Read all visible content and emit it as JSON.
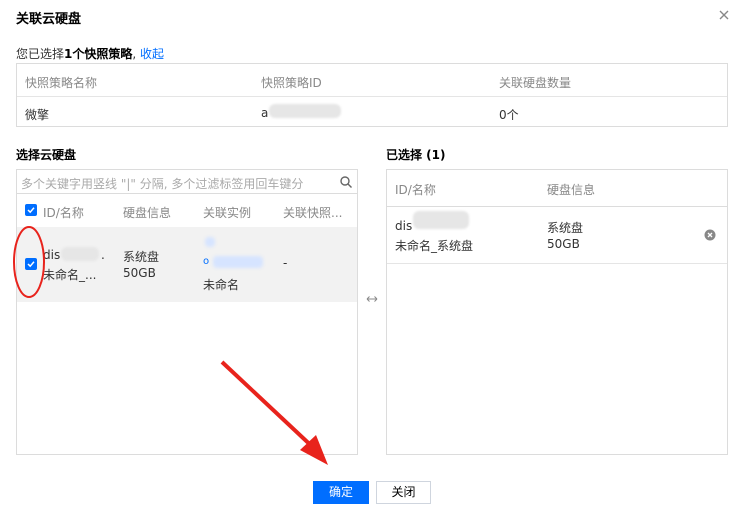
{
  "dialog": {
    "title": "关联云硬盘",
    "summary_prefix": "您已选择",
    "summary_count": "1个快照策略",
    "summary_sep": ", ",
    "collapse_link": "收起"
  },
  "policy_table": {
    "headers": [
      "快照策略名称",
      "快照策略ID",
      "关联硬盘数量"
    ],
    "row": {
      "name": "微擎",
      "id": "a",
      "disk_count": "0个"
    }
  },
  "select_section": {
    "title": "选择云硬盘",
    "search_placeholder": "多个关键字用竖线 \"|\" 分隔, 多个过滤标签用回车键分",
    "headers": [
      "ID/名称",
      "硬盘信息",
      "关联实例",
      "关联快照..."
    ],
    "rows": [
      {
        "id": "dis",
        "id_suffix": ".",
        "name": "未命名_...",
        "disk_type": "系统盘",
        "disk_size": "50GB",
        "instance_id": "o",
        "instance_name": "未命名",
        "snapshot": "-",
        "checked": true
      }
    ]
  },
  "selected_section": {
    "title": "已选择 (1)",
    "headers": [
      "ID/名称",
      "硬盘信息"
    ],
    "rows": [
      {
        "id": "dis",
        "name": "未命名_系统盘",
        "disk_type": "系统盘",
        "disk_size": "50GB"
      }
    ]
  },
  "buttons": {
    "confirm": "确定",
    "close": "关闭"
  },
  "colors": {
    "primary": "#006eff",
    "annotation": "#e8231c"
  }
}
